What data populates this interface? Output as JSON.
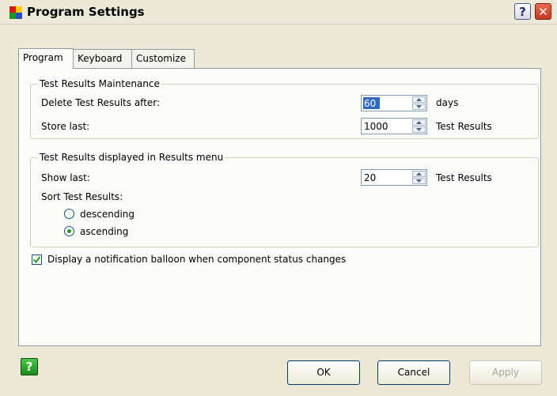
{
  "window": {
    "title": "Program Settings",
    "help_glyph": "?",
    "close_glyph": "✕"
  },
  "tabs": [
    {
      "label": "Program",
      "active": true
    },
    {
      "label": "Keyboard",
      "active": false
    },
    {
      "label": "Customize",
      "active": false
    }
  ],
  "maintenance": {
    "legend": "Test Results Maintenance",
    "delete_label": "Delete Test Results after:",
    "delete_value": "60",
    "delete_unit": "days",
    "store_label": "Store last:",
    "store_value": "1000",
    "store_unit": "Test Results"
  },
  "results_menu": {
    "legend": "Test Results displayed in Results menu",
    "show_label": "Show last:",
    "show_value": "20",
    "show_unit": "Test Results",
    "sort_label": "Sort Test Results:",
    "options": [
      {
        "label": "descending",
        "selected": false
      },
      {
        "label": "ascending",
        "selected": true
      }
    ]
  },
  "notification": {
    "label": "Display a notification balloon when component status changes",
    "checked": true
  },
  "footer": {
    "help_glyph": "?",
    "ok_label": "OK",
    "cancel_label": "Cancel",
    "apply_label": "Apply",
    "apply_enabled": false
  },
  "colors": {
    "face": "#ece9d8",
    "panel": "#fbfbf9",
    "border": "#919b9c",
    "selection": "#316ac5",
    "radio_dot": "#21a121",
    "close_red": "#c23b20"
  },
  "icons": {
    "app": "app-icon",
    "help": "help-icon",
    "close": "close-icon"
  }
}
